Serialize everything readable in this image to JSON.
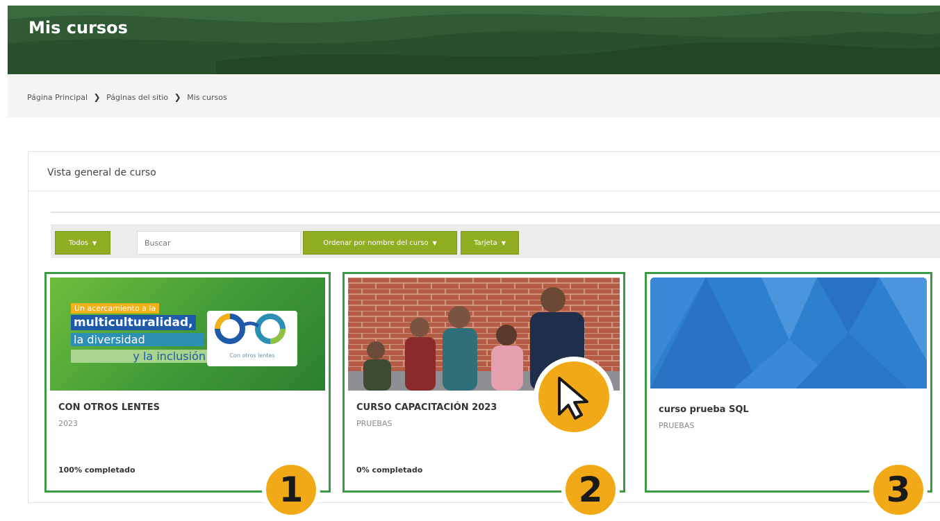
{
  "header": {
    "title": "Mis cursos"
  },
  "breadcrumb": {
    "items": [
      "Página Principal",
      "Páginas del sitio",
      "Mis cursos"
    ]
  },
  "overview": {
    "title": "Vista general de curso",
    "filters": {
      "grouping_label": "Todos",
      "search_placeholder": "Buscar",
      "sort_label": "Ordenar por nombre del curso",
      "view_label": "Tarjeta"
    }
  },
  "courses": [
    {
      "title": "CON OTROS LENTES",
      "category": "2023",
      "progress": "100% completado",
      "image_text": {
        "line1": "Un acercamiento a la",
        "line2": "multiculturalidad,",
        "line3": "la diversidad",
        "line4": "y la inclusión",
        "logo_caption": "Con otros lentes"
      }
    },
    {
      "title": "CURSO CAPACITACIÓN 2023",
      "category": "PRUEBAS",
      "progress": "0% completado"
    },
    {
      "title": "curso prueba SQL",
      "category": "PRUEBAS",
      "progress": ""
    }
  ],
  "badges": [
    "1",
    "2",
    "3"
  ],
  "icons": {
    "cursor": "pointer-cursor-icon"
  },
  "colors": {
    "banner": "#2f5a34",
    "accent": "#8fae22",
    "card_border": "#3a9b45",
    "badge": "#f2a917"
  }
}
